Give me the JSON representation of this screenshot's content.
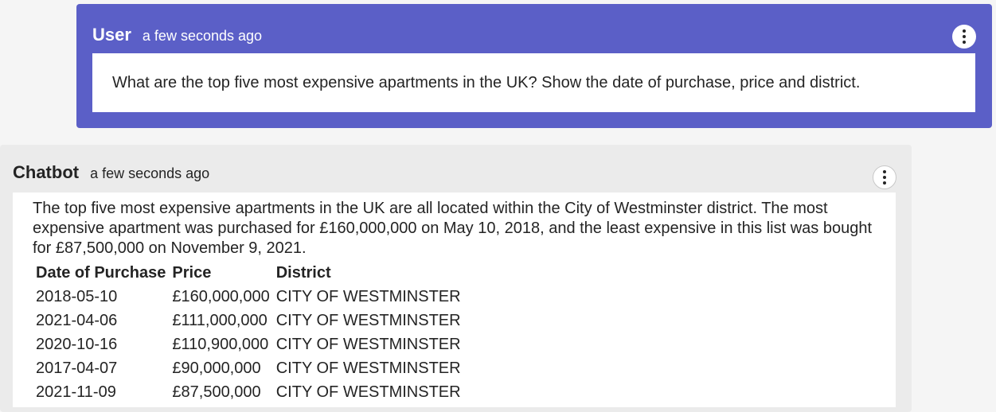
{
  "user_message": {
    "author": "User",
    "timestamp": "a few seconds ago",
    "text": "What are the top five most expensive apartments in the UK? Show the date of purchase, price and district."
  },
  "bot_message": {
    "author": "Chatbot",
    "timestamp": "a few seconds ago",
    "text": "The top five most expensive apartments in the UK are all located within the City of Westminster district. The most expensive apartment was purchased for £160,000,000 on May 10, 2018, and the least expensive in this list was bought for £87,500,000 on November 9, 2021.",
    "table": {
      "headers": [
        "Date of Purchase",
        "Price",
        "District"
      ],
      "rows": [
        [
          "2018-05-10",
          "£160,000,000",
          "CITY OF WESTMINSTER"
        ],
        [
          "2021-04-06",
          "£111,000,000",
          "CITY OF WESTMINSTER"
        ],
        [
          "2020-10-16",
          "£110,900,000",
          "CITY OF WESTMINSTER"
        ],
        [
          "2017-04-07",
          "£90,000,000",
          "CITY OF WESTMINSTER"
        ],
        [
          "2021-11-09",
          "£87,500,000",
          "CITY OF WESTMINSTER"
        ]
      ]
    }
  },
  "icons": {
    "more_options": "more-vertical-icon"
  },
  "colors": {
    "user_card": "#5b5fc7",
    "bot_card": "#ebebeb",
    "background": "#f5f5f5"
  }
}
